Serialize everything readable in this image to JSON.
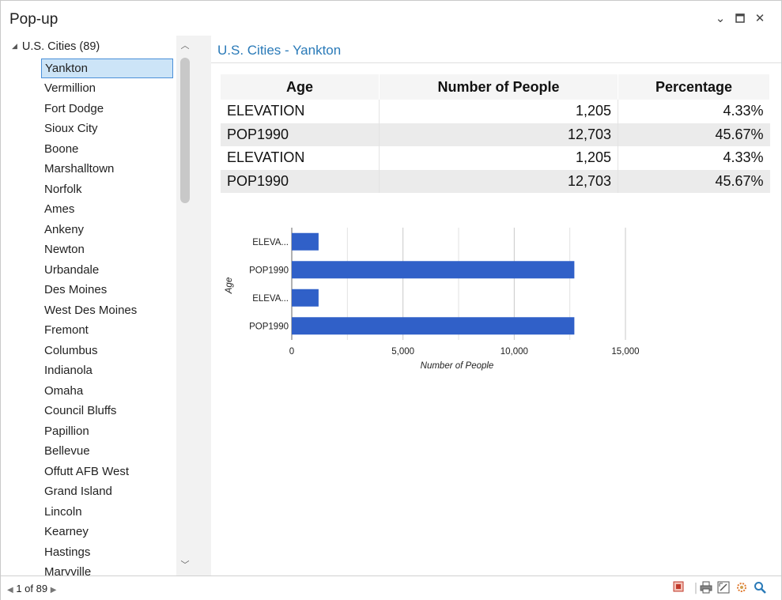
{
  "window": {
    "title": "Pop-up",
    "controls": {
      "minimize": "⌄",
      "maximize": "□",
      "close": "✕"
    }
  },
  "tree": {
    "root_label": "U.S. Cities (89)",
    "items": [
      "Yankton",
      "Vermillion",
      "Fort Dodge",
      "Sioux City",
      "Boone",
      "Marshalltown",
      "Norfolk",
      "Ames",
      "Ankeny",
      "Newton",
      "Urbandale",
      "Des Moines",
      "West Des Moines",
      "Fremont",
      "Columbus",
      "Indianola",
      "Omaha",
      "Council Bluffs",
      "Papillion",
      "Bellevue",
      "Offutt AFB West",
      "Grand Island",
      "Lincoln",
      "Kearney",
      "Hastings",
      "Maryville"
    ],
    "selected": "Yankton"
  },
  "popup": {
    "heading": "U.S. Cities - Yankton",
    "table": {
      "headers": [
        "Age",
        "Number of People",
        "Percentage"
      ],
      "rows": [
        [
          "ELEVATION",
          "1,205",
          "4.33%"
        ],
        [
          "POP1990",
          "12,703",
          "45.67%"
        ],
        [
          "ELEVATION",
          "1,205",
          "4.33%"
        ],
        [
          "POP1990",
          "12,703",
          "45.67%"
        ]
      ]
    }
  },
  "chart_data": {
    "type": "bar",
    "orientation": "horizontal",
    "categories": [
      "ELEVA...",
      "POP1990",
      "ELEVA...",
      "POP1990"
    ],
    "values": [
      1205,
      12703,
      1205,
      12703
    ],
    "xlabel": "Number of People",
    "ylabel": "Age",
    "xlim": [
      0,
      15000
    ],
    "xticks": [
      "0",
      "5,000",
      "10,000",
      "15,000"
    ],
    "bar_color": "#3060c8",
    "grid": true
  },
  "footer": {
    "pager": "1 of 89"
  },
  "colors": {
    "accent": "#2a7ab8",
    "selection": "#cce4f7"
  }
}
